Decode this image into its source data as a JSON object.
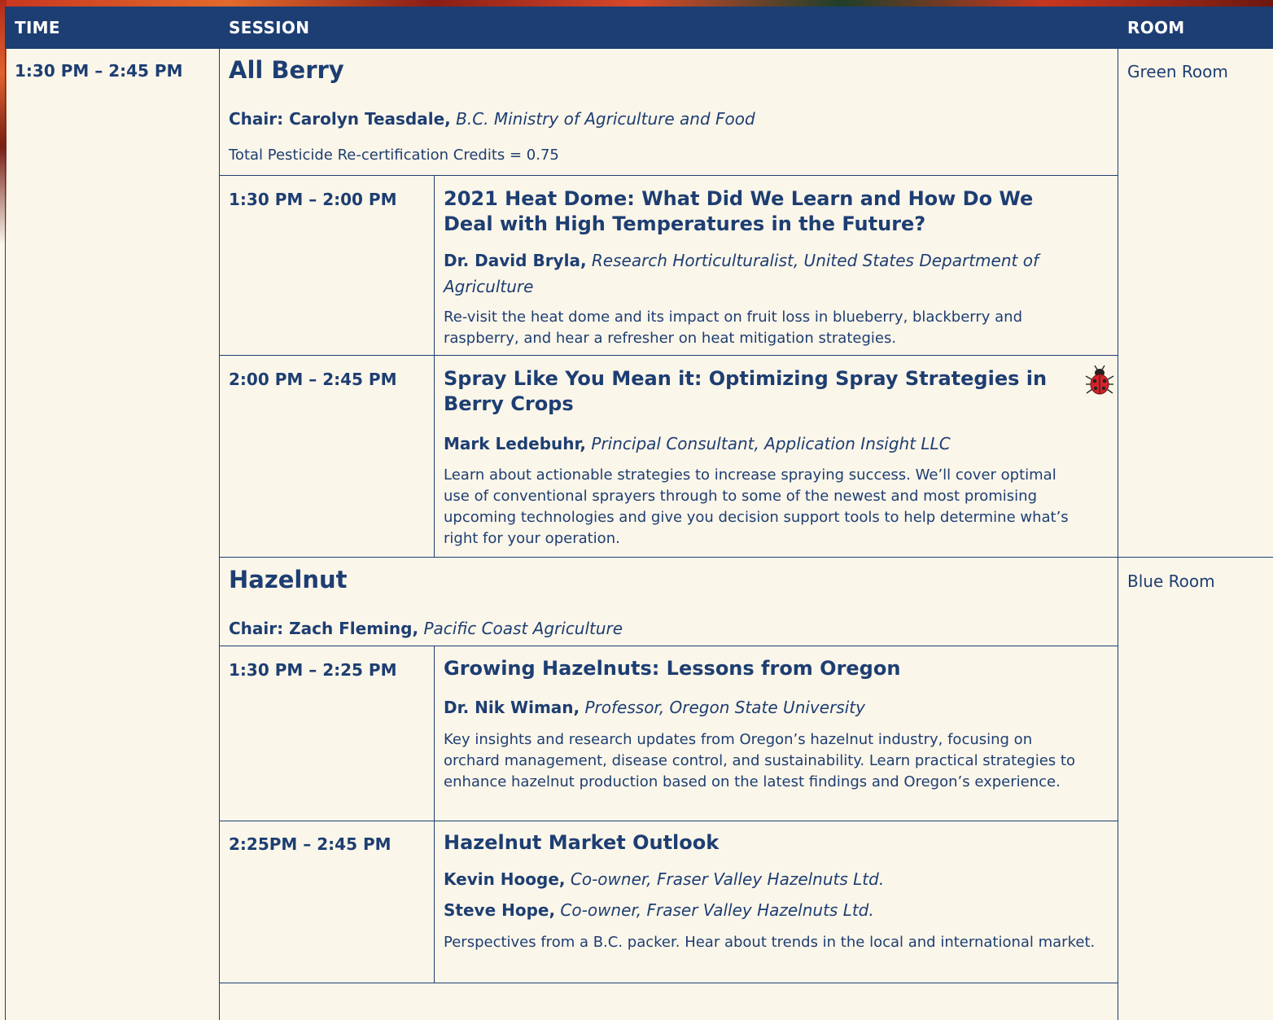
{
  "header": {
    "time_label": "TIME",
    "session_label": "SESSION",
    "room_label": "ROOM"
  },
  "block_time": "1:30 PM – 2:45 PM",
  "tracks": [
    {
      "title": "All Berry",
      "chair_label": "Chair: Carolyn Teasdale,",
      "chair_org": "B.C. Ministry of Agriculture and Food",
      "credits": "Total Pesticide Re-certification Credits = 0.75",
      "room": "Green Room",
      "sessions": [
        {
          "time": "1:30 PM – 2:00 PM",
          "title": "2021 Heat Dome: What Did We Learn and How Do We Deal with High Temperatures in the Future?",
          "speakers": [
            {
              "name": "Dr. David Bryla,",
              "role": "Research Horticulturalist, United States Department of Agriculture"
            }
          ],
          "description": "Re-visit the heat dome and its impact on fruit loss in blueberry, blackberry and raspberry, and hear a refresher on heat mitigation strategies."
        },
        {
          "time": "2:00 PM – 2:45 PM",
          "title": "Spray Like You Mean it: Optimizing Spray Strategies in Berry Crops",
          "icon": "ladybug-icon",
          "speakers": [
            {
              "name": "Mark Ledebuhr,",
              "role": "Principal Consultant, Application Insight LLC"
            }
          ],
          "description": "Learn about actionable strategies to increase spraying success. We’ll cover optimal use of conventional sprayers through to some of the newest and most promising upcoming technologies and give you decision support tools to help determine what’s right for your operation."
        }
      ]
    },
    {
      "title": "Hazelnut",
      "chair_label": "Chair: Zach Fleming,",
      "chair_org": "Pacific Coast Agriculture",
      "room": "Blue Room",
      "sessions": [
        {
          "time": "1:30 PM – 2:25 PM",
          "title": "Growing Hazelnuts: Lessons from Oregon",
          "speakers": [
            {
              "name": "Dr. Nik Wiman,",
              "role": "Professor, Oregon State University"
            }
          ],
          "description": "Key insights and research updates from Oregon’s hazelnut industry, focusing on orchard management, disease control, and sustainability. Learn practical strategies to enhance hazelnut production based on the latest findings and Oregon’s experience."
        },
        {
          "time": "2:25PM – 2:45 PM",
          "title": "Hazelnut Market Outlook",
          "speakers": [
            {
              "name": "Kevin Hooge,",
              "role": "Co-owner, Fraser Valley Hazelnuts Ltd."
            },
            {
              "name": "Steve Hope,",
              "role": "Co-owner, Fraser Valley Hazelnuts Ltd."
            }
          ],
          "description": "Perspectives from a B.C. packer. Hear about trends in the local and international market."
        }
      ]
    }
  ],
  "colors": {
    "navy": "#1d3e72",
    "cream": "#fbf6ea",
    "ladybug_red": "#d3232a"
  }
}
